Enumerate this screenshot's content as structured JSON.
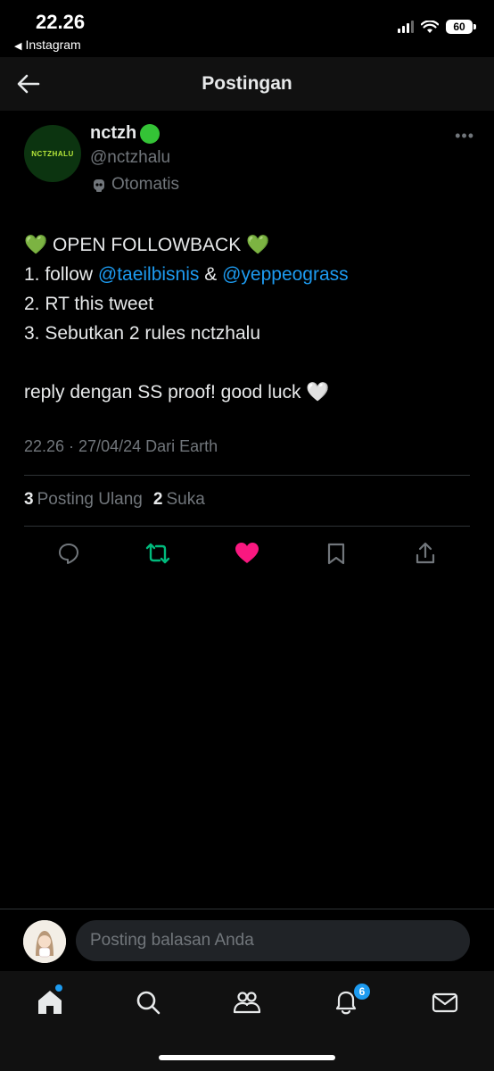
{
  "status_bar": {
    "time": "22.26",
    "back_app": "Instagram",
    "battery": "60"
  },
  "header": {
    "title": "Postingan"
  },
  "tweet": {
    "display_name": "nctzh",
    "handle": "@nctzhalu",
    "label": "Otomatis",
    "avatar_text": "NCTZHALU",
    "lines": {
      "l1": "OPEN FOLLOWBACK",
      "l2_prefix": "1. follow ",
      "mention1": "@taeilbisnis",
      "amp": " & ",
      "mention2": "@yeppeograss",
      "l3": "2. RT this tweet",
      "l4": "3. Sebutkan 2 rules nctzhalu",
      "l5": "reply dengan SS proof! good luck"
    },
    "meta": "22.26 · 27/04/24 Dari Earth",
    "reposts_count": "3",
    "reposts_label": "Posting Ulang",
    "likes_count": "2",
    "likes_label": "Suka"
  },
  "reply": {
    "placeholder": "Posting balasan Anda"
  },
  "nav": {
    "notifications_badge": "6"
  },
  "colors": {
    "accent": "#1d9bf0",
    "retweet": "#00ba7c",
    "like": "#f91880"
  }
}
